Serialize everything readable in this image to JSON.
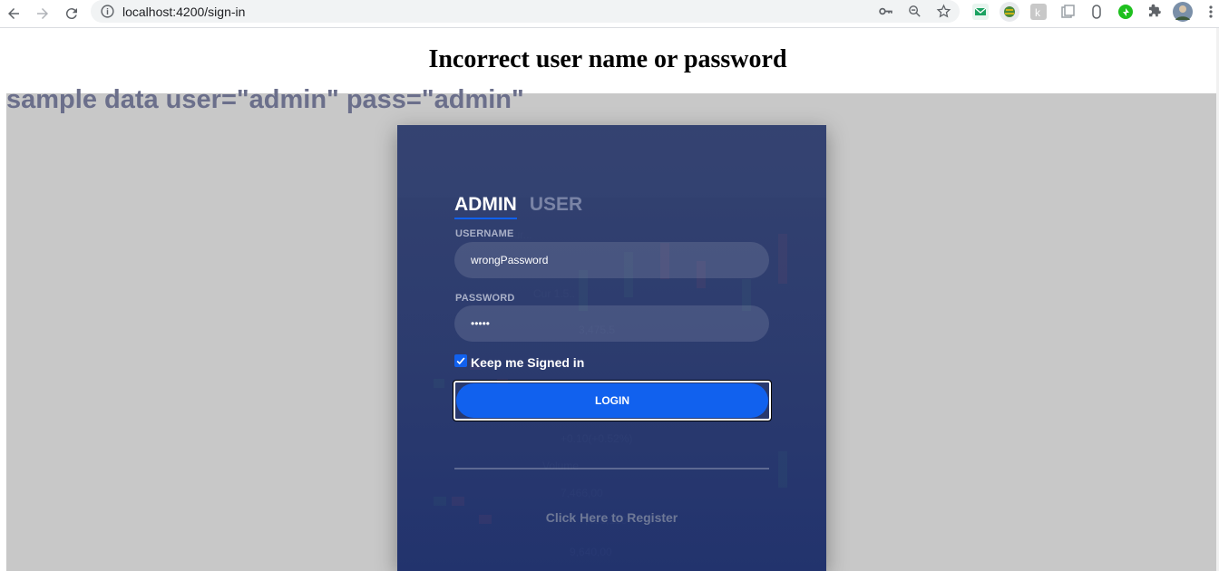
{
  "browser": {
    "url": "localhost:4200/sign-in",
    "extensions": [
      "mail-extension-icon",
      "globe-extension-icon",
      "k-extension-icon",
      "docs-extension-icon",
      "mouse-extension-icon",
      "green-extension-icon",
      "puzzle-icon",
      "profile-avatar"
    ]
  },
  "page": {
    "error_message": "Incorrect user name or password",
    "hint": "sample data user=\"admin\" pass=\"admin\""
  },
  "login": {
    "tabs": [
      {
        "label": "ADMIN",
        "active": true
      },
      {
        "label": "USER",
        "active": false
      }
    ],
    "username_label": "USERNAME",
    "username_value": "wrongPassword",
    "password_label": "PASSWORD",
    "password_value": "•••••",
    "keep_signed_in_label": "Keep me Signed in",
    "keep_signed_in_checked": true,
    "login_button": "LOGIN",
    "register_link": "Click Here to Register"
  },
  "colors": {
    "accent": "#1161ee",
    "card": "#3a4a78",
    "hint": "#6b6f8b"
  }
}
